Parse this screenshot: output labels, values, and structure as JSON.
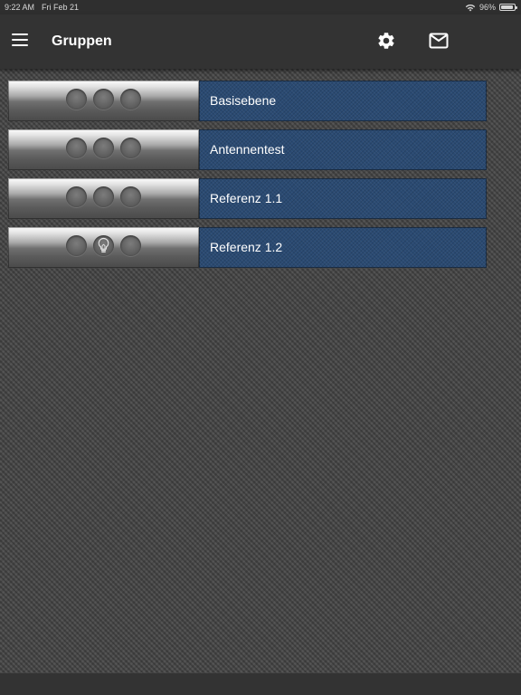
{
  "status_bar": {
    "time": "9:22 AM",
    "date": "Fri Feb 21",
    "battery": "96%",
    "battery_level": 0.96
  },
  "app_bar": {
    "title": "Gruppen",
    "menu_icon": "hamburger-menu-icon",
    "settings_icon": "gear-icon",
    "mail_icon": "envelope-icon"
  },
  "groups": [
    {
      "name": "Basisebene",
      "lamps": [
        "off",
        "off",
        "off"
      ]
    },
    {
      "name": "Antennentest",
      "lamps": [
        "off",
        "off",
        "off"
      ]
    },
    {
      "name": "Referenz 1.1",
      "lamps": [
        "off",
        "off",
        "off"
      ]
    },
    {
      "name": "Referenz 1.2",
      "lamps": [
        "off",
        "bulb",
        "off"
      ]
    }
  ],
  "colors": {
    "name_panel": "#2a4a72",
    "app_bar": "#333333",
    "background": "#4a4a4a"
  }
}
